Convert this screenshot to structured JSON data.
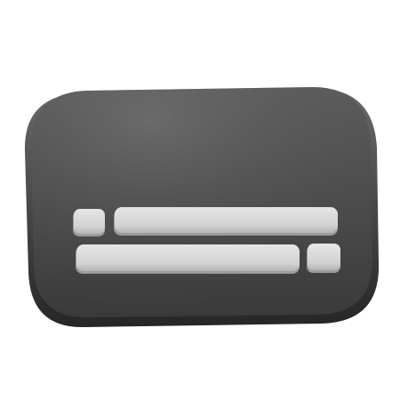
{
  "icon": {
    "name": "subtitles-card-icon",
    "colors": {
      "card_body": "#4f4f4f",
      "card_edge": "#2f2f2f",
      "card_highlight": "#6e6e6e",
      "bar_fill": "#d6d6d6",
      "bar_shadow": "#a8a8a8",
      "background": "#ffffff"
    },
    "bars": [
      {
        "row": 1,
        "kind": "short"
      },
      {
        "row": 1,
        "kind": "long"
      },
      {
        "row": 2,
        "kind": "long"
      },
      {
        "row": 2,
        "kind": "short"
      }
    ]
  }
}
